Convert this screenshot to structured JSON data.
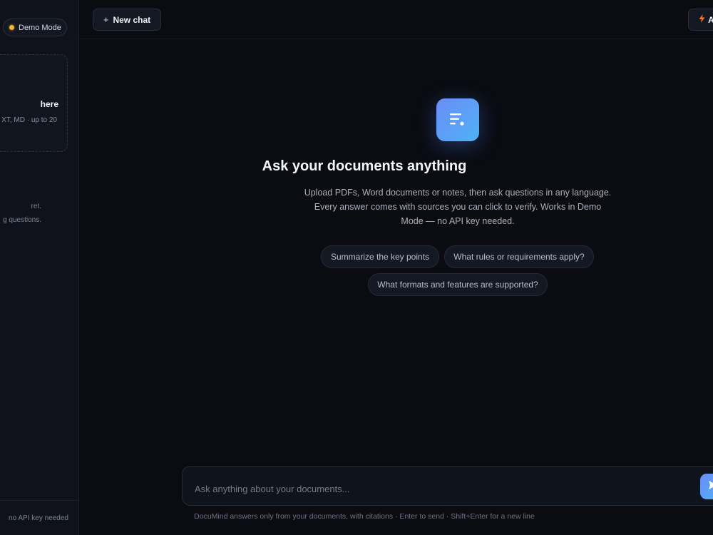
{
  "sidebar": {
    "mode_badge": "Demo Mode",
    "upload": {
      "title": "here",
      "subtitle": "XT, MD · up to 20"
    },
    "empty_state": {
      "line1": "ret.",
      "line2": "g questions."
    },
    "footer_text": "no API key needed"
  },
  "topbar": {
    "new_chat_icon": "+",
    "new_chat_label": "New chat",
    "right_button_icon": "bolt-icon",
    "right_button_label": "A"
  },
  "hero": {
    "icon": "document-lines-icon",
    "title": "Ask your documents anything",
    "description_line1": "Upload PDFs, Word documents or notes, then ask questions in any language.",
    "description_line2": "Every answer comes with sources you can click to verify. Works in Demo",
    "description_line3": "Mode — no API key needed."
  },
  "suggestions": [
    "Summarize the key points",
    "What rules or requirements apply?",
    "What formats and features are supported?"
  ],
  "composer": {
    "placeholder": "Ask anything about your documents...",
    "send_icon": "send-icon",
    "hint": "DocuMind answers only from your documents, with citations · Enter to send · Shift+Enter for a new line"
  },
  "colors": {
    "background": "#0a0c12",
    "sidebar": "#0f121a",
    "accent_start": "#6b8cf7",
    "accent_end": "#4fb2f7",
    "demo_dot": "#f5b82e",
    "bolt": "#f2762e"
  }
}
